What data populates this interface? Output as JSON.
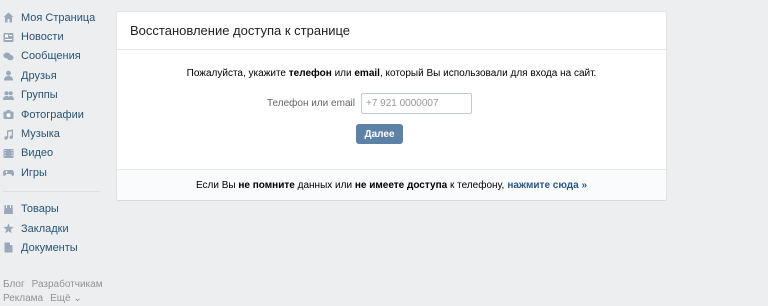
{
  "sidebar": {
    "items": [
      {
        "label": "Моя Страница",
        "icon": "home-icon"
      },
      {
        "label": "Новости",
        "icon": "news-icon"
      },
      {
        "label": "Сообщения",
        "icon": "messages-icon"
      },
      {
        "label": "Друзья",
        "icon": "friend-icon"
      },
      {
        "label": "Группы",
        "icon": "groups-icon"
      },
      {
        "label": "Фотографии",
        "icon": "camera-icon"
      },
      {
        "label": "Музыка",
        "icon": "music-icon"
      },
      {
        "label": "Видео",
        "icon": "video-icon"
      },
      {
        "label": "Игры",
        "icon": "gamepad-icon"
      }
    ],
    "items2": [
      {
        "label": "Товары",
        "icon": "goods-icon"
      },
      {
        "label": "Закладки",
        "icon": "star-icon"
      },
      {
        "label": "Документы",
        "icon": "document-icon"
      }
    ],
    "footer": {
      "blog": "Блог",
      "developers": "Разработчикам",
      "ads": "Реклама",
      "more": "Ещё ⌄"
    }
  },
  "card": {
    "title": "Восстановление доступа к странице",
    "prompt": {
      "pre": "Пожалуйста, укажите ",
      "phone": "телефон",
      "or": " или ",
      "email": "email",
      "post": ", который Вы использовали для входа на сайт."
    },
    "field_label": "Телефон или email",
    "field_placeholder": "+7 921 0000007",
    "next_label": "Далее",
    "footer": {
      "pre": "Если Вы ",
      "b1": "не помните",
      "mid": " данных или ",
      "b2": "не имеете доступа",
      "post": " к телефону,",
      "link": "нажмите сюда »"
    }
  },
  "colors": {
    "background": "#edeef0",
    "link": "#285473",
    "button": "#5e81a8"
  }
}
